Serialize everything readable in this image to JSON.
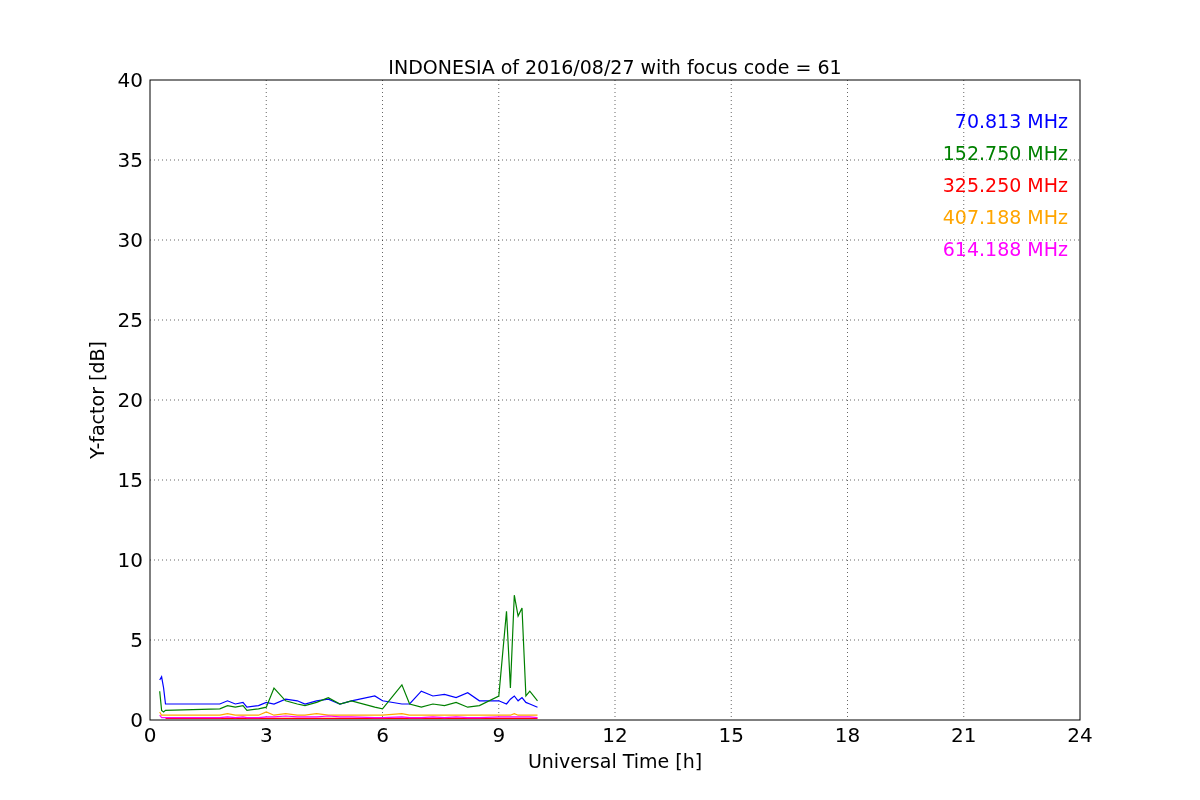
{
  "chart_data": {
    "type": "line",
    "title": "INDONESIA of 2016/08/27 with focus code = 61",
    "xlabel": "Universal Time [h]",
    "ylabel": "Y-factor [dB]",
    "x": [
      0.25,
      0.3,
      0.35,
      0.4,
      1.8,
      2.0,
      2.2,
      2.4,
      2.5,
      2.8,
      3.0,
      3.2,
      3.5,
      3.8,
      4.0,
      4.3,
      4.6,
      4.9,
      5.2,
      5.8,
      6.0,
      6.5,
      6.7,
      7.0,
      7.3,
      7.6,
      7.9,
      8.2,
      8.5,
      9.0,
      9.2,
      9.3,
      9.4,
      9.5,
      9.6,
      9.7,
      9.8,
      10.0
    ],
    "series": [
      {
        "name": "70.813 MHz",
        "color": "#0000ff",
        "values": [
          2.5,
          2.7,
          2.0,
          1.0,
          1.0,
          1.2,
          1.0,
          1.1,
          0.8,
          0.9,
          1.1,
          1.0,
          1.3,
          1.2,
          1.0,
          1.2,
          1.3,
          1.0,
          1.2,
          1.5,
          1.2,
          1.0,
          1.0,
          1.8,
          1.5,
          1.6,
          1.4,
          1.7,
          1.2,
          1.2,
          1.0,
          1.3,
          1.5,
          1.2,
          1.4,
          1.1,
          1.0,
          0.8
        ]
      },
      {
        "name": "152.750 MHz",
        "color": "#008000",
        "values": [
          1.8,
          0.6,
          0.5,
          0.6,
          0.7,
          0.9,
          0.8,
          0.9,
          0.6,
          0.7,
          0.8,
          2.0,
          1.2,
          1.0,
          0.9,
          1.1,
          1.4,
          1.0,
          1.2,
          0.8,
          0.7,
          2.2,
          1.0,
          0.8,
          1.0,
          0.9,
          1.1,
          0.8,
          0.9,
          1.5,
          6.8,
          2.0,
          7.8,
          6.5,
          7.0,
          1.5,
          1.8,
          1.2
        ]
      },
      {
        "name": "325.250 MHz",
        "color": "#ff0000",
        "values": [
          null,
          null,
          null,
          0.1,
          0.1,
          0.1,
          0.1,
          0.1,
          0.1,
          0.1,
          0.1,
          0.1,
          0.1,
          0.1,
          0.1,
          0.1,
          0.1,
          0.1,
          0.1,
          0.1,
          0.1,
          0.1,
          0.1,
          0.1,
          0.1,
          0.1,
          0.1,
          0.1,
          0.1,
          0.1,
          0.1,
          0.1,
          0.1,
          0.1,
          0.1,
          0.1,
          0.1,
          0.1
        ]
      },
      {
        "name": "407.188 MHz",
        "color": "#ffa500",
        "values": [
          0.5,
          0.3,
          0.3,
          0.3,
          0.3,
          0.4,
          0.3,
          0.3,
          0.3,
          0.3,
          0.5,
          0.3,
          0.4,
          0.3,
          0.3,
          0.4,
          0.3,
          0.3,
          0.3,
          0.3,
          0.3,
          0.4,
          0.3,
          0.3,
          0.3,
          0.3,
          0.3,
          0.3,
          0.3,
          0.3,
          0.3,
          0.3,
          0.4,
          0.3,
          0.3,
          0.3,
          0.3,
          0.3
        ]
      },
      {
        "name": "614.188 MHz",
        "color": "#ff00ff",
        "values": [
          0.3,
          0.15,
          0.15,
          0.15,
          0.15,
          0.2,
          0.15,
          0.2,
          0.15,
          0.15,
          0.2,
          0.2,
          0.25,
          0.2,
          0.2,
          0.2,
          0.25,
          0.2,
          0.2,
          0.15,
          0.15,
          0.2,
          0.15,
          0.15,
          0.2,
          0.15,
          0.2,
          0.15,
          0.15,
          0.2,
          0.2,
          0.2,
          0.2,
          0.2,
          0.2,
          0.2,
          0.2,
          0.15
        ]
      }
    ],
    "grid": true,
    "xlim": [
      0,
      24
    ],
    "ylim": [
      0,
      40
    ],
    "xticks": [
      0,
      3,
      6,
      9,
      12,
      15,
      18,
      21,
      24
    ],
    "yticks": [
      0,
      5,
      10,
      15,
      20,
      25,
      30,
      35,
      40
    ]
  }
}
